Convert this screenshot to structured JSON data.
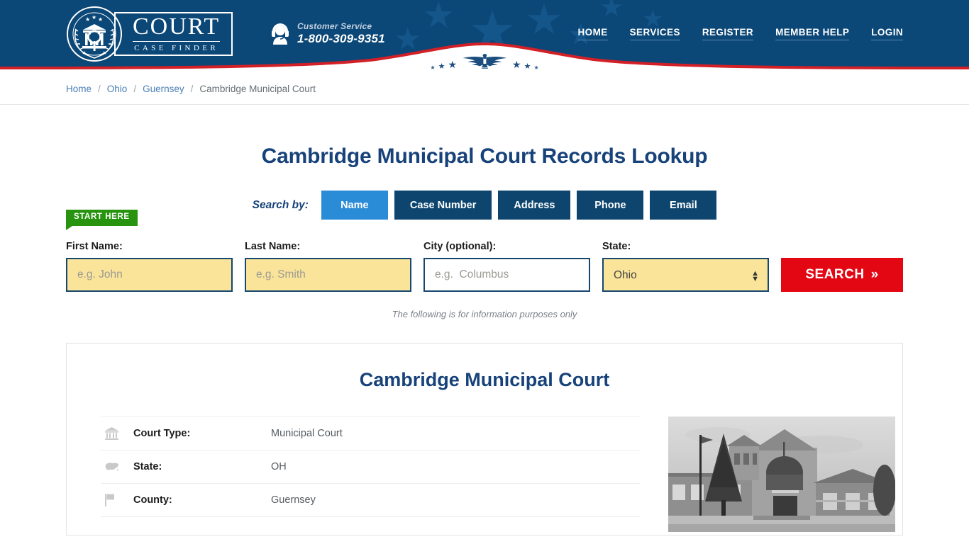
{
  "header": {
    "logo": {
      "title": "COURT",
      "subtitle": "CASE FINDER",
      "seal_icon": "court-seal-icon"
    },
    "customer_service": {
      "icon": "headset-support-icon",
      "label": "Customer Service",
      "phone": "1-800-309-9351"
    },
    "nav": [
      {
        "label": "HOME"
      },
      {
        "label": "SERVICES"
      },
      {
        "label": "REGISTER"
      },
      {
        "label": "MEMBER HELP"
      },
      {
        "label": "LOGIN"
      }
    ],
    "banner_icon": "eagle-emblem-icon",
    "colors": {
      "navy": "#0b4777",
      "red": "#d32027",
      "star": "#14558a"
    }
  },
  "breadcrumb": {
    "items": [
      {
        "label": "Home",
        "current": false
      },
      {
        "label": "Ohio",
        "current": false
      },
      {
        "label": "Guernsey",
        "current": false
      },
      {
        "label": "Cambridge Municipal Court",
        "current": true
      }
    ],
    "separator": "/"
  },
  "main": {
    "page_title": "Cambridge Municipal Court Records Lookup",
    "search_by": {
      "label": "Search by:",
      "tabs": [
        {
          "label": "Name",
          "active": true
        },
        {
          "label": "Case Number",
          "active": false
        },
        {
          "label": "Address",
          "active": false
        },
        {
          "label": "Phone",
          "active": false
        },
        {
          "label": "Email",
          "active": false
        }
      ]
    },
    "form": {
      "start_here_badge": "START HERE",
      "fields": [
        {
          "label": "First Name:",
          "placeholder": "e.g. John",
          "value": "",
          "highlighted": true
        },
        {
          "label": "Last Name:",
          "placeholder": "e.g. Smith",
          "value": "",
          "highlighted": true
        },
        {
          "label": "City (optional):",
          "placeholder": "e.g.  Columbus",
          "value": "",
          "highlighted": false
        }
      ],
      "state": {
        "label": "State:",
        "selected": "Ohio",
        "options": [
          "Ohio"
        ]
      },
      "search_button": {
        "label": "SEARCH",
        "chevron": "»"
      }
    },
    "disclaimer": "The following is for information purposes only"
  },
  "court_card": {
    "name": "Cambridge Municipal Court",
    "rows": [
      {
        "icon": "bank-building-icon",
        "key": "Court Type:",
        "value": "Municipal Court"
      },
      {
        "icon": "map-usa-icon",
        "key": "State:",
        "value": "OH"
      },
      {
        "icon": "flag-icon",
        "key": "County:",
        "value": "Guernsey"
      }
    ],
    "photo": {
      "alt": "courthouse-photo",
      "style": "grayscale"
    }
  }
}
